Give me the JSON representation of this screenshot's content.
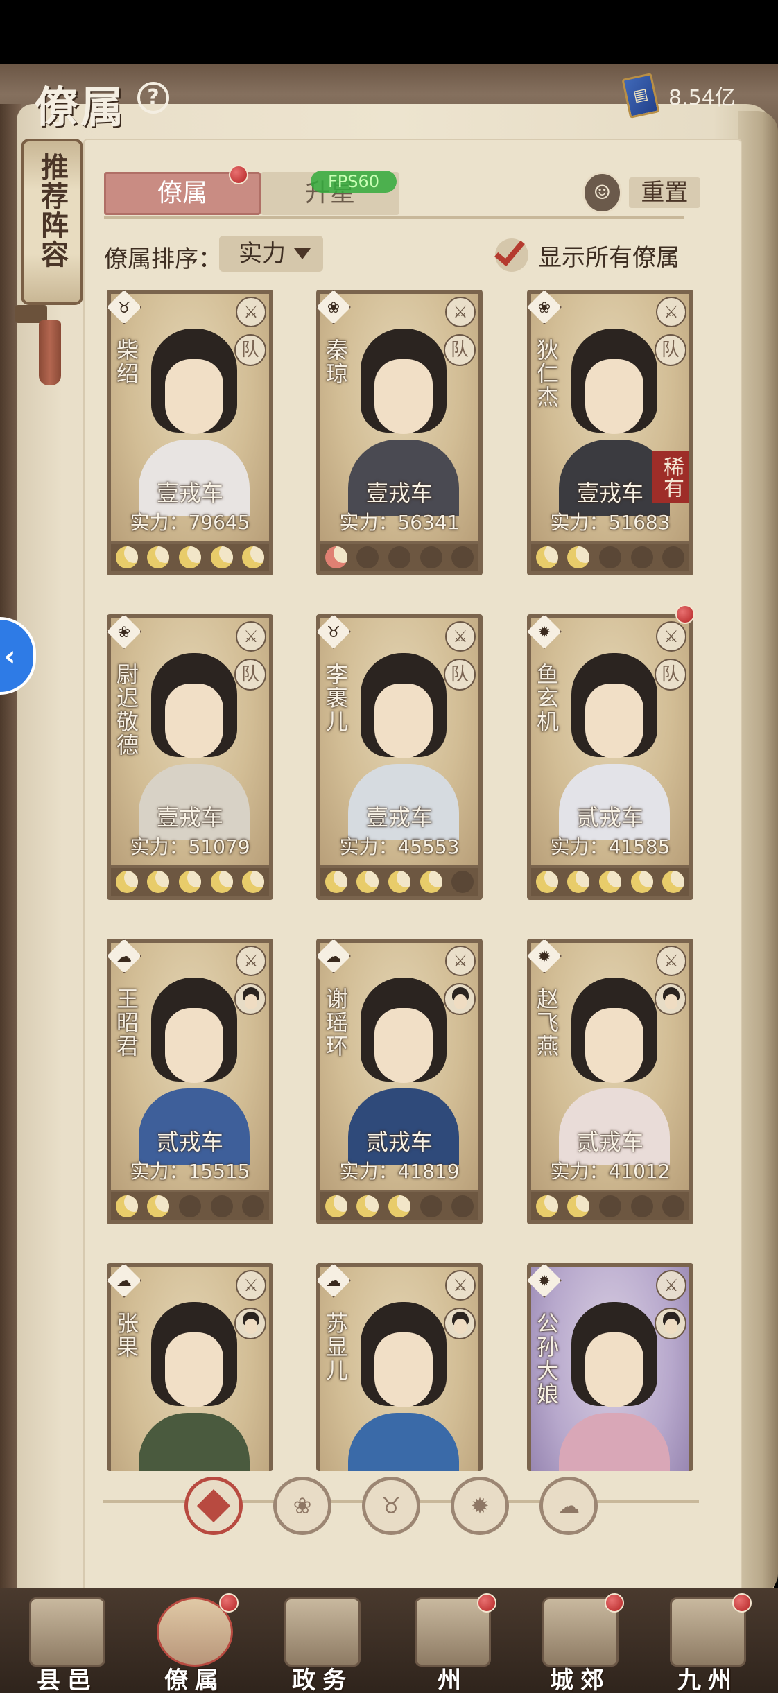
{
  "header": {
    "title": "僚属",
    "help": "?",
    "currency_value": "8.54亿",
    "currency_icon": "book-currency-icon"
  },
  "banner": {
    "text": "推荐阵容"
  },
  "tabs": [
    {
      "label": "僚属",
      "active": true,
      "red_dot": true
    },
    {
      "label": "升星",
      "active": false
    }
  ],
  "fps": "FPS60",
  "reset": {
    "label": "重置"
  },
  "sort": {
    "label": "僚属排序：",
    "value": "实力"
  },
  "show_all": {
    "label": "显示所有僚属",
    "checked": true
  },
  "cards": [
    {
      "name": "柴绍",
      "rank": "壹戎车",
      "power": "实力：79645",
      "moons": 5,
      "type_icon": "ox-icon",
      "team": "队"
    },
    {
      "name": "秦琼",
      "rank": "壹戎车",
      "power": "实力：56341",
      "moons": 0,
      "red_moon": true,
      "type_icon": "lotus-icon",
      "team": "队"
    },
    {
      "name": "狄仁杰",
      "rank": "壹戎车",
      "power": "实力：51683",
      "moons": 2,
      "type_icon": "lotus-icon",
      "team": "队",
      "rare": "稀有"
    },
    {
      "name": "尉迟敬德",
      "rank": "壹戎车",
      "power": "实力：51079",
      "moons": 5,
      "type_icon": "lotus-icon",
      "team": "队"
    },
    {
      "name": "李裹儿",
      "rank": "壹戎车",
      "power": "实力：45553",
      "moons": 4,
      "type_icon": "ox-icon",
      "team": "队"
    },
    {
      "name": "鱼玄机",
      "rank": "贰戎车",
      "power": "实力：41585",
      "moons": 5,
      "type_icon": "fan-icon",
      "team": "队",
      "red_dot": true
    },
    {
      "name": "王昭君",
      "rank": "贰戎车",
      "power": "实力：15515",
      "moons": 2,
      "type_icon": "cloud-icon"
    },
    {
      "name": "谢瑶环",
      "rank": "贰戎车",
      "power": "实力：41819",
      "moons": 3,
      "type_icon": "cloud-icon"
    },
    {
      "name": "赵飞燕",
      "rank": "贰戎车",
      "power": "实力：41012",
      "moons": 2,
      "type_icon": "fan-icon"
    },
    {
      "name": "张果",
      "type_icon": "cloud-icon"
    },
    {
      "name": "苏显儿",
      "type_icon": "cloud-icon"
    },
    {
      "name": "公孙大娘",
      "type_icon": "fan-icon",
      "purple": true
    }
  ],
  "filters": [
    "all-filter-icon",
    "lotus-filter-icon",
    "ox-filter-icon",
    "fan-filter-icon",
    "cloud-filter-icon"
  ],
  "nav": [
    {
      "label": "县邑",
      "red_dot": false
    },
    {
      "label": "僚属",
      "red_dot": true,
      "active": true
    },
    {
      "label": "政务",
      "red_dot": false
    },
    {
      "label": "州",
      "red_dot": true
    },
    {
      "label": "城郊",
      "red_dot": true
    },
    {
      "label": "九州",
      "red_dot": true
    }
  ]
}
